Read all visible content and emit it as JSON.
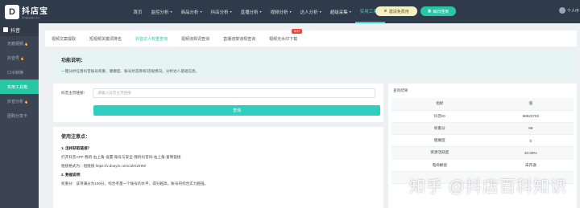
{
  "app": {
    "name": "抖店宝",
    "sub": "Dongkedian.com"
  },
  "nav": [
    {
      "label": "首页",
      "caret": false
    },
    {
      "label": "监控分析",
      "caret": true
    },
    {
      "label": "商品分析",
      "caret": true
    },
    {
      "label": "抖店分析",
      "caret": true
    },
    {
      "label": "直播分析",
      "caret": true
    },
    {
      "label": "视频分析",
      "caret": true
    },
    {
      "label": "达人分析",
      "caret": true
    },
    {
      "label": "超级采集",
      "caret": true
    },
    {
      "label": "实用工具",
      "caret": true,
      "active": true
    }
  ],
  "header": {
    "vip": "邀请免费用",
    "sign": "每日签到",
    "user": "个人中"
  },
  "sidebar": {
    "title": "抖音",
    "items": [
      {
        "label": "无痕视频",
        "hot": true
      },
      {
        "label": "抖音号",
        "hot": true
      },
      {
        "label": "口令转换",
        "hot": false
      },
      {
        "label": "实用工具箱",
        "hot": false,
        "active": true
      },
      {
        "label": "抖音分析",
        "hot": true
      },
      {
        "label": "团购分享卡"
      }
    ]
  },
  "tabs": [
    {
      "label": "视频文案提取"
    },
    {
      "label": "短视频关键词排名"
    },
    {
      "label": "抖音达人权重查询",
      "active": true
    },
    {
      "label": "视频违规词查询"
    },
    {
      "label": "直播违禁违规查询"
    },
    {
      "label": "视频无水印下载",
      "hot": "HOT"
    }
  ],
  "desc": {
    "title": "功能说明：",
    "text": "一键分析任意抖音账号权重、健康度、账号状态降权/违规情况，分析达人基础信息。"
  },
  "form": {
    "label": "抖音主页链接：",
    "placeholder": "请输入抖音主页链接",
    "button": "查询"
  },
  "usage": {
    "title": "使用注意点：",
    "lines": [
      {
        "text": "1. 怎样获取链接？",
        "bold": true
      },
      {
        "text": "打开抖音APP-我的-右上角-设置-账号与安全-我的抖音码-右上角-复制链接",
        "bold": false
      },
      {
        "text": "链接格式为：短链接 https://v.douyin.com/J2rKZHM/",
        "bold": false
      },
      {
        "text": "2. 数据说明",
        "bold": true
      },
      {
        "text": "权重分：该项满分为100分，综合考量一个账号的水平，得分越高，账号的综合实力越强。",
        "bold": false
      }
    ]
  },
  "result": {
    "title": "查询结果",
    "header": [
      "指标",
      "值"
    ],
    "rows": [
      {
        "name": "抖音ID",
        "value": "88842702",
        "red": false
      },
      {
        "name": "权重分",
        "value": "65",
        "red": false
      },
      {
        "name": "健康度",
        "value": "0",
        "red": true
      },
      {
        "name": "资源活跃度",
        "value": "40.00%",
        "red": true
      },
      {
        "name": "电商橱窗",
        "value": "未开通",
        "red": true
      },
      {
        "name": "",
        "value": "",
        "red": false
      }
    ]
  },
  "watermark": "知乎 @抖店百科知识"
}
